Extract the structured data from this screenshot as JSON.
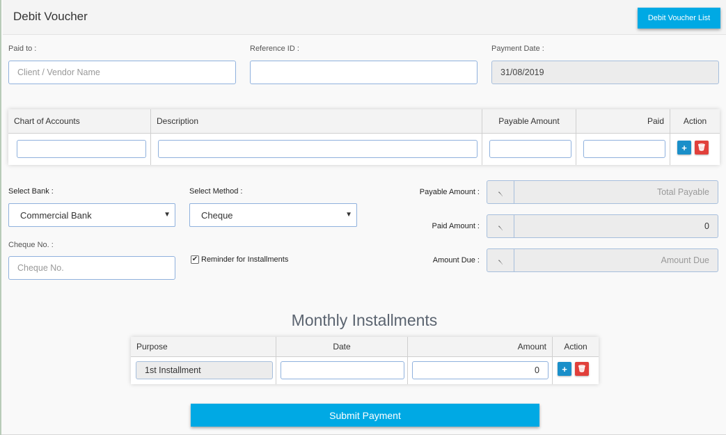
{
  "header": {
    "title": "Debit Voucher",
    "list_button": "Debit Voucher List"
  },
  "form": {
    "paid_to": {
      "label": "Paid to :",
      "placeholder": "Client / Vendor Name"
    },
    "reference_id": {
      "label": "Reference ID :",
      "value": ""
    },
    "payment_date": {
      "label": "Payment Date :",
      "value": "31/08/2019"
    }
  },
  "accounts_table": {
    "columns": [
      "Chart of Accounts",
      "Description",
      "Payable Amount",
      "Paid",
      "Action"
    ],
    "add_icon": "+",
    "delete_icon": "🗑"
  },
  "bank": {
    "label": "Select Bank :",
    "value": "Commercial Bank"
  },
  "method": {
    "label": "Select Method :",
    "value": "Cheque"
  },
  "cheque": {
    "label": "Cheque No. :",
    "placeholder": "Cheque No."
  },
  "reminder": {
    "label": "Reminder for Installments",
    "checked": true,
    "check_glyph": "✔"
  },
  "totals": {
    "currency_symbol": "৲",
    "payable": {
      "label": "Payable Amount :",
      "placeholder": "Total Payable"
    },
    "paid": {
      "label": "Paid Amount :",
      "value": "0"
    },
    "due": {
      "label": "Amount Due :",
      "placeholder": "Amount Due"
    }
  },
  "installments": {
    "title": "Monthly Installments",
    "columns": [
      "Purpose",
      "Date",
      "Amount",
      "Action"
    ],
    "row": {
      "purpose": "1st Installment",
      "date": "",
      "amount": "0"
    },
    "add_icon": "+",
    "delete_icon": "🗑"
  },
  "submit_label": "Submit Payment",
  "colors": {
    "accent": "#00a9e4",
    "danger": "#e1403b",
    "add": "#1a8fc9",
    "input_border": "#8fb1dd"
  }
}
